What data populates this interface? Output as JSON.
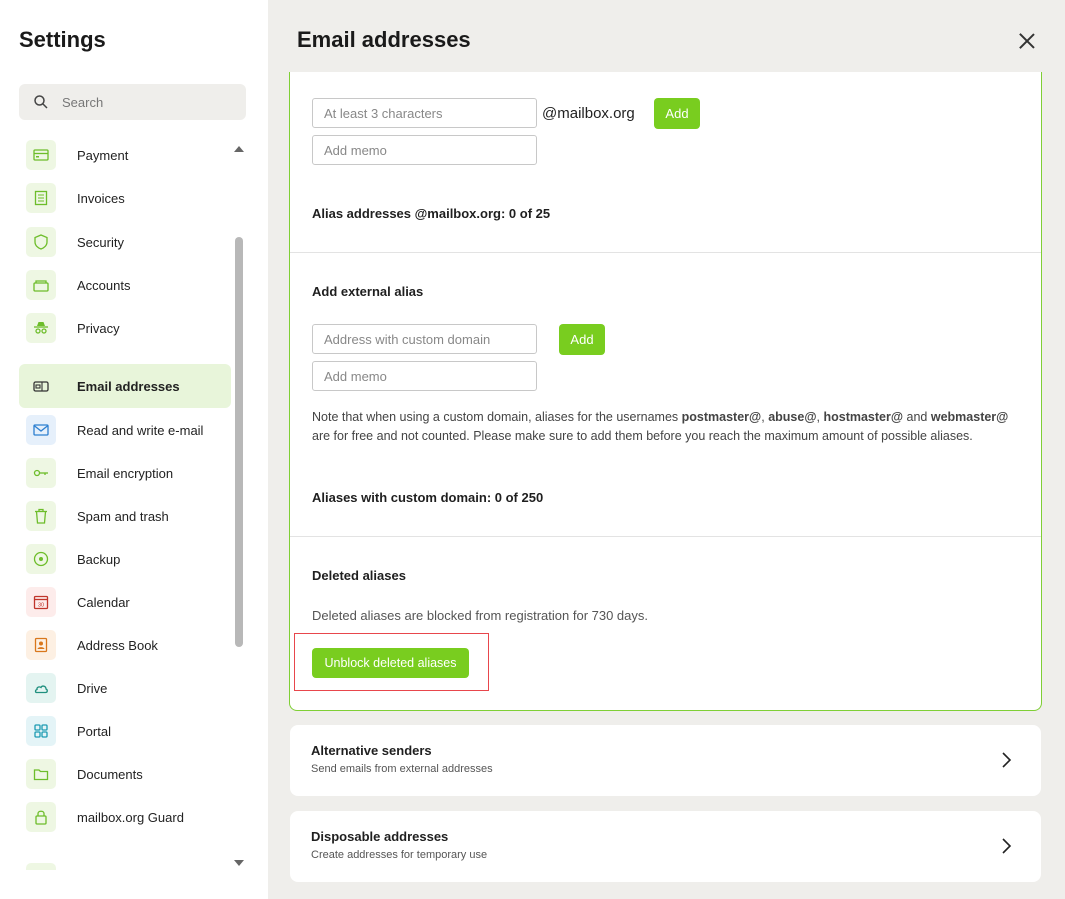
{
  "sidebar": {
    "title": "Settings",
    "search_placeholder": "Search",
    "items": [
      {
        "label": "Payment",
        "icon": "credit-card-icon"
      },
      {
        "label": "Invoices",
        "icon": "invoice-icon"
      },
      {
        "label": "Security",
        "icon": "shield-icon"
      },
      {
        "label": "Accounts",
        "icon": "accounts-icon"
      },
      {
        "label": "Privacy",
        "icon": "spy-icon"
      },
      {
        "label": "Email addresses",
        "icon": "mailbox-icon"
      },
      {
        "label": "Read and write e-mail",
        "icon": "envelope-icon"
      },
      {
        "label": "Email encryption",
        "icon": "key-icon"
      },
      {
        "label": "Spam and trash",
        "icon": "trash-icon"
      },
      {
        "label": "Backup",
        "icon": "backup-icon"
      },
      {
        "label": "Calendar",
        "icon": "calendar-icon"
      },
      {
        "label": "Address Book",
        "icon": "address-book-icon"
      },
      {
        "label": "Drive",
        "icon": "cloud-icon"
      },
      {
        "label": "Portal",
        "icon": "grid-icon"
      },
      {
        "label": "Documents",
        "icon": "folder-icon"
      },
      {
        "label": "mailbox.org Guard",
        "icon": "lock-icon"
      }
    ],
    "calendar_day": "30"
  },
  "main": {
    "title": "Email addresses",
    "alias": {
      "input_placeholder": "At least 3 characters",
      "domain_suffix": "@mailbox.org",
      "add_label": "Add",
      "memo_placeholder": "Add memo",
      "count_text": "Alias addresses @mailbox.org: 0 of 25"
    },
    "external": {
      "heading": "Add external alias",
      "input_placeholder": "Address with custom domain",
      "add_label": "Add",
      "memo_placeholder": "Add memo",
      "note_parts": {
        "prefix": "Note that when using a custom domain, aliases for the usernames ",
        "u1": "postmaster@",
        "sep1": ", ",
        "u2": "abuse@",
        "sep2": ", ",
        "u3": "hostmaster@",
        "sep3": " and ",
        "u4": "webmaster@",
        "suffix": " are for free and not counted. Please make sure to add them before you reach the maximum amount of possible aliases."
      },
      "count_text": "Aliases with custom domain: 0 of 250"
    },
    "deleted": {
      "heading": "Deleted aliases",
      "description": "Deleted aliases are blocked from registration for 730 days.",
      "button_label": "Unblock deleted aliases"
    },
    "cards": [
      {
        "title": "Alternative senders",
        "subtitle": "Send emails from external addresses"
      },
      {
        "title": "Disposable addresses",
        "subtitle": "Create addresses for temporary use"
      }
    ]
  },
  "colors": {
    "accent": "#79cd1f",
    "highlight": "#e8464c",
    "active_bg": "#e8f5da"
  }
}
